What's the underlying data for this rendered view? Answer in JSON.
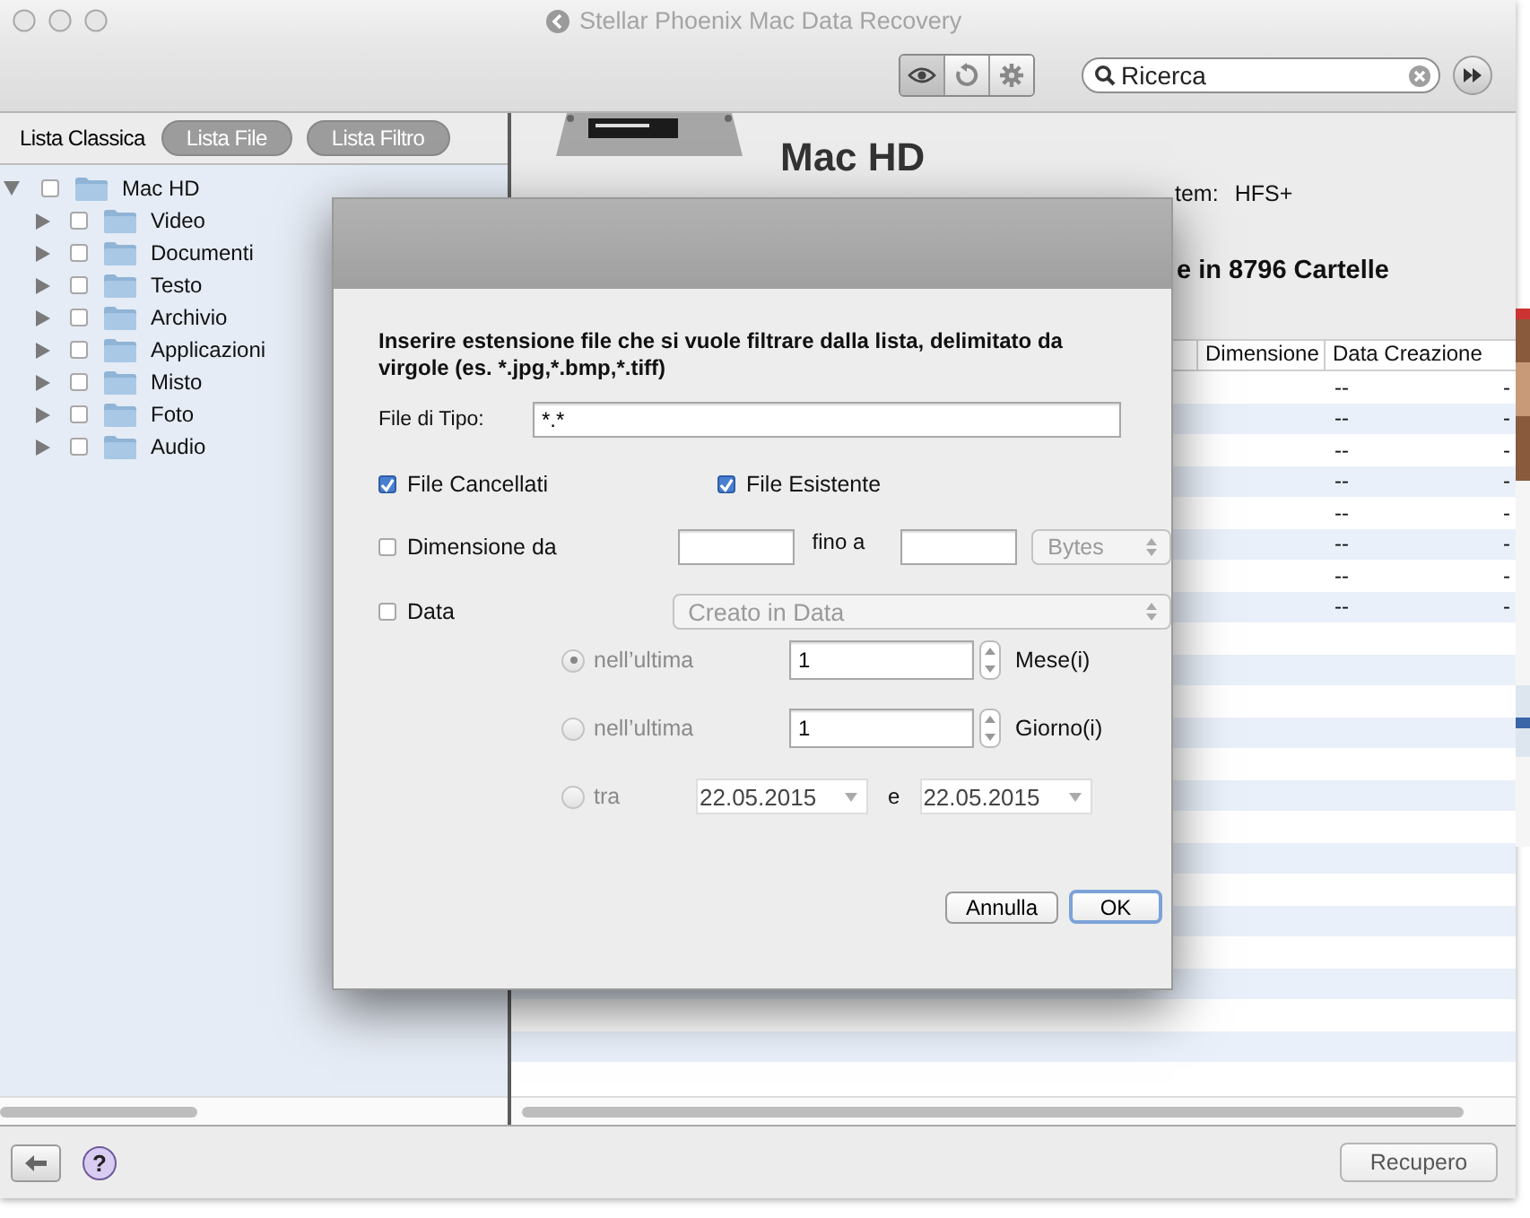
{
  "window": {
    "title": "Stellar Phoenix Mac Data Recovery"
  },
  "search": {
    "placeholder": "Ricerca"
  },
  "view_tabs": [
    {
      "label": "Lista Classica",
      "selected": true
    },
    {
      "label": "Lista File",
      "selected": false
    },
    {
      "label": "Lista  Filtro",
      "selected": false
    }
  ],
  "tree": {
    "label": "Mac HD",
    "expanded": true,
    "checked": false,
    "children": [
      {
        "label": "Video",
        "expanded": false,
        "checked": false
      },
      {
        "label": "Documenti",
        "expanded": false,
        "checked": false
      },
      {
        "label": "Testo",
        "expanded": false,
        "checked": false
      },
      {
        "label": "Archivio",
        "expanded": false,
        "checked": false
      },
      {
        "label": "Applicazioni",
        "expanded": false,
        "checked": false
      },
      {
        "label": "Misto",
        "expanded": false,
        "checked": false
      },
      {
        "label": "Foto",
        "expanded": false,
        "checked": false
      },
      {
        "label": "Audio",
        "expanded": false,
        "checked": false
      }
    ]
  },
  "drive": {
    "name": "Mac HD",
    "file_system_label": "tem:",
    "file_system": "HFS+",
    "summary": "e in 8796 Cartelle"
  },
  "table": {
    "columns": [
      "",
      "Dimensione",
      "Data Creazione"
    ],
    "rows": [
      [
        "",
        "",
        "--",
        "-"
      ],
      [
        "",
        "",
        "--",
        "-"
      ],
      [
        "",
        "",
        "--",
        "-"
      ],
      [
        "",
        "",
        "--",
        "-"
      ],
      [
        "",
        "",
        "--",
        "-"
      ],
      [
        "",
        "",
        "--",
        "-"
      ],
      [
        "",
        "",
        "--",
        "-"
      ],
      [
        "",
        "",
        "--",
        "-"
      ]
    ]
  },
  "dialog": {
    "instruction": "Inserire estensione file che si vuole filtrare dalla lista, delimitato da virgole (es. *.jpg,*.bmp,*.tiff)",
    "type_label": "File di Tipo:",
    "type_value": "*.*",
    "options": [
      {
        "label": "File Cancellati",
        "checked": true
      },
      {
        "label": "File Esistente",
        "checked": true
      }
    ],
    "size_filter": {
      "label": "Dimensione da",
      "checked": false,
      "to_label": "fino a",
      "unit": "Bytes",
      "disabled": true
    },
    "date_filter": {
      "label": "Data",
      "checked": false,
      "field": "Creato in Data",
      "disabled": true
    },
    "date_modes": [
      {
        "kind": "count",
        "label": "nell’ultima",
        "selected": true,
        "disabled": true,
        "value": "1",
        "unit": "Mese(i)"
      },
      {
        "kind": "count",
        "label": "nell’ultima",
        "selected": false,
        "disabled": true,
        "value": "1",
        "unit": "Giorno(i)"
      },
      {
        "kind": "range",
        "label": "tra",
        "selected": false,
        "disabled": true,
        "from": "22.05.2015",
        "joiner": "e",
        "to": "22.05.2015"
      }
    ],
    "buttons": [
      {
        "label": "Annulla",
        "default": false
      },
      {
        "label": "OK",
        "default": true
      }
    ]
  },
  "bottom_bar": {
    "help": "?",
    "recover_button": "Recupero"
  }
}
